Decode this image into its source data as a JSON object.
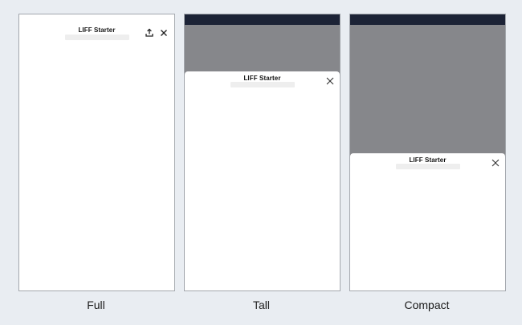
{
  "modes": [
    {
      "id": "full",
      "caption": "Full",
      "title": "LIFF Starter",
      "icons": [
        "share-icon",
        "close-icon"
      ]
    },
    {
      "id": "tall",
      "caption": "Tall",
      "title": "LIFF Starter",
      "icons": [
        "close-icon"
      ]
    },
    {
      "id": "compact",
      "caption": "Compact",
      "title": "LIFF Starter",
      "icons": [
        "close-icon"
      ]
    }
  ],
  "colors": {
    "page_background": "#e9edf2",
    "status_bar": "#1c2336",
    "dim_overlay": "#86878b",
    "view_background": "#ffffff"
  }
}
